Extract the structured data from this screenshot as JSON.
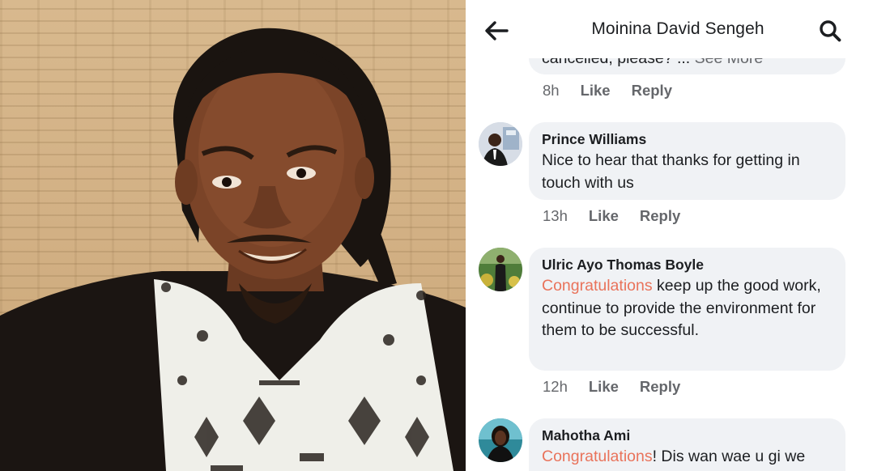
{
  "header": {
    "title": "Moinina David Sengeh",
    "back_icon": "arrow-left-icon",
    "search_icon": "search-icon"
  },
  "comments": [
    {
      "partial_text": "cancelled, please? ...",
      "see_more": "See More",
      "time": "8h",
      "like": "Like",
      "reply": "Reply"
    },
    {
      "author": "Prince Williams",
      "text": "Nice to hear that thanks for getting in touch with us",
      "time": "13h",
      "like": "Like",
      "reply": "Reply"
    },
    {
      "author": "Ulric Ayo Thomas Boyle",
      "mention": "Congratulations",
      "text": " keep up the good work, continue to provide the environment for them to be successful.",
      "time": "12h",
      "like": "Like",
      "reply": "Reply"
    },
    {
      "author": "Mahotha Ami",
      "mention": "Congratulations",
      "text": "! Dis wan wae u gi we"
    }
  ],
  "colors": {
    "mention": "#e9735b",
    "bubble": "#f0f2f5",
    "meta": "#65676b"
  }
}
